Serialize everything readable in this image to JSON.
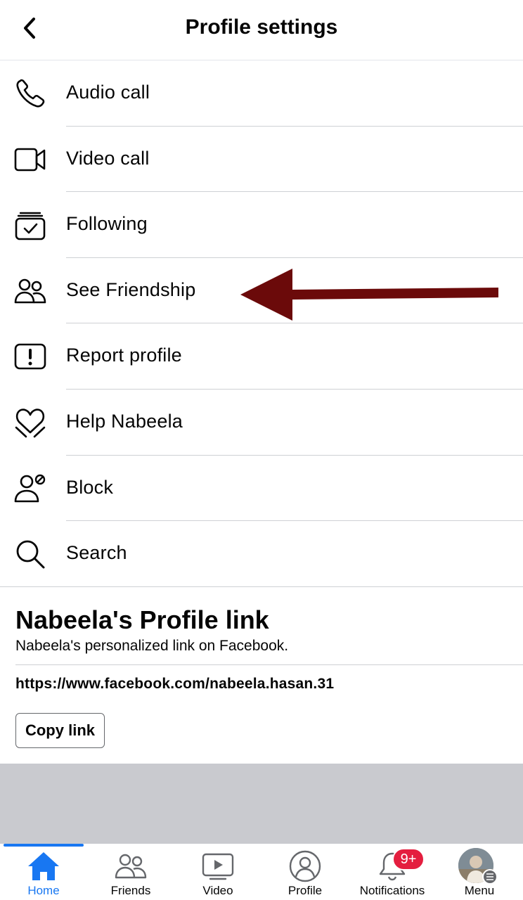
{
  "header": {
    "title": "Profile settings",
    "back_icon": "chevron-left-icon"
  },
  "menu_items": [
    {
      "label": "Audio call",
      "icon": "phone-icon"
    },
    {
      "label": "Video call",
      "icon": "video-camera-icon"
    },
    {
      "label": "Following",
      "icon": "following-check-icon"
    },
    {
      "label": "See Friendship",
      "icon": "friends-icon"
    },
    {
      "label": "Report profile",
      "icon": "report-icon"
    },
    {
      "label": "Help Nabeela",
      "icon": "heart-hands-icon"
    },
    {
      "label": "Block",
      "icon": "block-user-icon"
    },
    {
      "label": "Search",
      "icon": "search-icon"
    }
  ],
  "annotation": {
    "arrow_color": "#6b0a0a",
    "points_to": "See Friendship"
  },
  "profile_link": {
    "title": "Nabeela's Profile link",
    "subtitle": "Nabeela's personalized link on Facebook.",
    "url": "https://www.facebook.com/nabeela.hasan.31",
    "copy_label": "Copy link"
  },
  "tabbar": {
    "tabs": [
      {
        "label": "Home",
        "icon": "home-icon",
        "active": true
      },
      {
        "label": "Friends",
        "icon": "friends-tab-icon",
        "active": false
      },
      {
        "label": "Video",
        "icon": "video-play-icon",
        "active": false
      },
      {
        "label": "Profile",
        "icon": "profile-icon",
        "active": false
      },
      {
        "label": "Notifications",
        "icon": "bell-icon",
        "active": false,
        "badge": "9+"
      },
      {
        "label": "Menu",
        "icon": "avatar-menu-icon",
        "active": false
      }
    ]
  },
  "colors": {
    "accent": "#1877f2",
    "badge": "#e41e3f",
    "text": "#050505",
    "divider": "#ced0d4",
    "gray_area": "#c9cacf"
  }
}
